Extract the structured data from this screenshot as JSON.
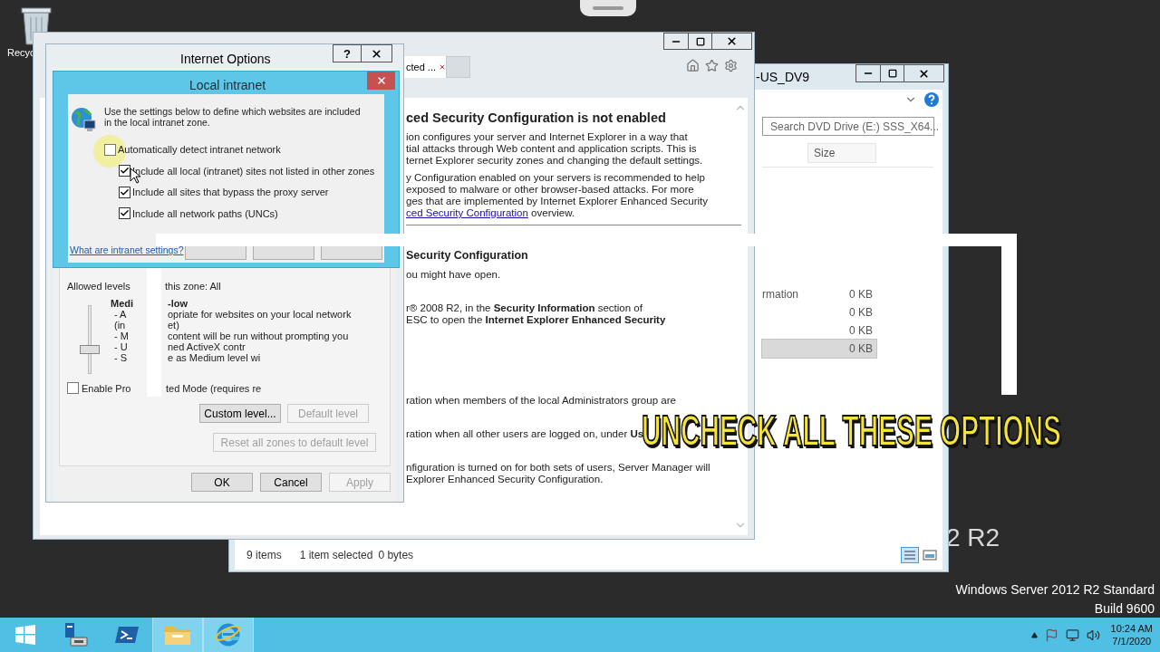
{
  "desktop": {
    "recycle_bin_label": "Recyc",
    "big_watermark": "2 R2",
    "edition": "Windows Server 2012 R2 Standard",
    "build": "Build 9600"
  },
  "explorer": {
    "title": "-US_DV9",
    "search_placeholder": "Search DVD Drive (E:) SSS_X64...",
    "column": "Size",
    "rows": [
      {
        "name": "rmation",
        "size": "0 KB",
        "selected": false
      },
      {
        "size": "0 KB",
        "selected": false
      },
      {
        "size": "0 KB",
        "selected": false
      },
      {
        "size": "0 KB",
        "selected": true
      }
    ],
    "status": {
      "count": "9 items",
      "selection": "1 item selected",
      "bytes": "0 bytes"
    }
  },
  "ie": {
    "tab": "cted ...",
    "sections": [
      {
        "heading": "ced Security Configuration is not enabled",
        "paragraphs": [
          {
            "kind": "text",
            "lines": [
              "ion configures your server and Internet Explorer in a way that",
              "tial attacks through Web content and application scripts. This is",
              "ternet Explorer security zones and changing the default settings."
            ]
          },
          {
            "kind": "text",
            "lines": [
              "y Configuration enabled on your servers is recommended to help",
              "exposed to malware or other browser-based attacks. For more",
              "ges that are implemented by Internet Explorer Enhanced Security"
            ],
            "link": "ced Security Configuration",
            "after_link": " overview."
          }
        ]
      },
      {
        "heading": "Security Configuration",
        "paragraphs": [
          {
            "kind": "text",
            "lines": [
              "ou might have open."
            ]
          },
          {
            "kind": "text",
            "lines": [
              "r® 2008 R2, in the **Security Information** section of",
              "ESC to open the **Internet Explorer Enhanced Security**"
            ]
          },
          {
            "kind": "obscured"
          },
          {
            "kind": "text",
            "lines": [
              "ration when members of the local Administrators group are"
            ]
          },
          {
            "kind": "text",
            "lines": [
              "ration when all other users are logged on, under **Us**"
            ]
          },
          {
            "kind": "text",
            "lines": [
              "nfiguration is turned on for both sets of users, Server Manager will",
              "Explorer Enhanced Security Configuration."
            ]
          }
        ]
      }
    ]
  },
  "internet_options": {
    "title": "Internet Options",
    "help": "?",
    "allowed": [
      "Allowed levels",
      "this zone: All"
    ],
    "level_name": [
      "Medi",
      "-low"
    ],
    "slider": {
      "level": 0.33
    },
    "details": [
      [
        "- A",
        "opriate for websites on your local network"
      ],
      [
        "(in",
        "et)"
      ],
      [
        "- M",
        "content will be run without prompting you"
      ],
      [
        "- U",
        "ned ActiveX contr"
      ],
      [
        "- S",
        "e as Medium level wi"
      ]
    ],
    "protected_mode": {
      "label": [
        "Enable Pro",
        "ted Mode (requires re"
      ],
      "checked": false
    },
    "zone_buttons": [
      {
        "label": "Custom level...",
        "disabled": false
      },
      {
        "label": "Default level",
        "disabled": true
      }
    ],
    "reset": {
      "label": "Reset all zones to default level",
      "disabled": true
    },
    "footer_buttons": [
      {
        "label": "OK",
        "disabled": false
      },
      {
        "label": "Cancel",
        "disabled": false
      },
      {
        "label": "Apply",
        "disabled": true
      }
    ]
  },
  "local_intranet": {
    "title": "Local intranet",
    "description": "Use the settings below to define which websites are included in the local intranet zone.",
    "options": [
      {
        "label": "Automatically detect intranet network",
        "checked": false,
        "children": [
          {
            "label": "Include all local (intranet) sites not listed in other zones",
            "checked": true
          },
          {
            "label": "Include all sites that bypass the proxy server",
            "checked": true
          },
          {
            "label": "Include all network paths (UNCs)",
            "checked": true
          }
        ]
      }
    ],
    "link": "What are intranet settings?"
  },
  "caption": "UNCHECK ALL THESE OPTIONS",
  "taskbar": {
    "items": [
      {
        "kind": "start",
        "running": false
      },
      {
        "kind": "server_manager",
        "running": false
      },
      {
        "kind": "powershell",
        "running": false
      },
      {
        "kind": "file_explorer",
        "running": true
      },
      {
        "kind": "internet_explorer",
        "running": true
      }
    ],
    "time": "10:24 AM",
    "date": "7/1/2020"
  }
}
